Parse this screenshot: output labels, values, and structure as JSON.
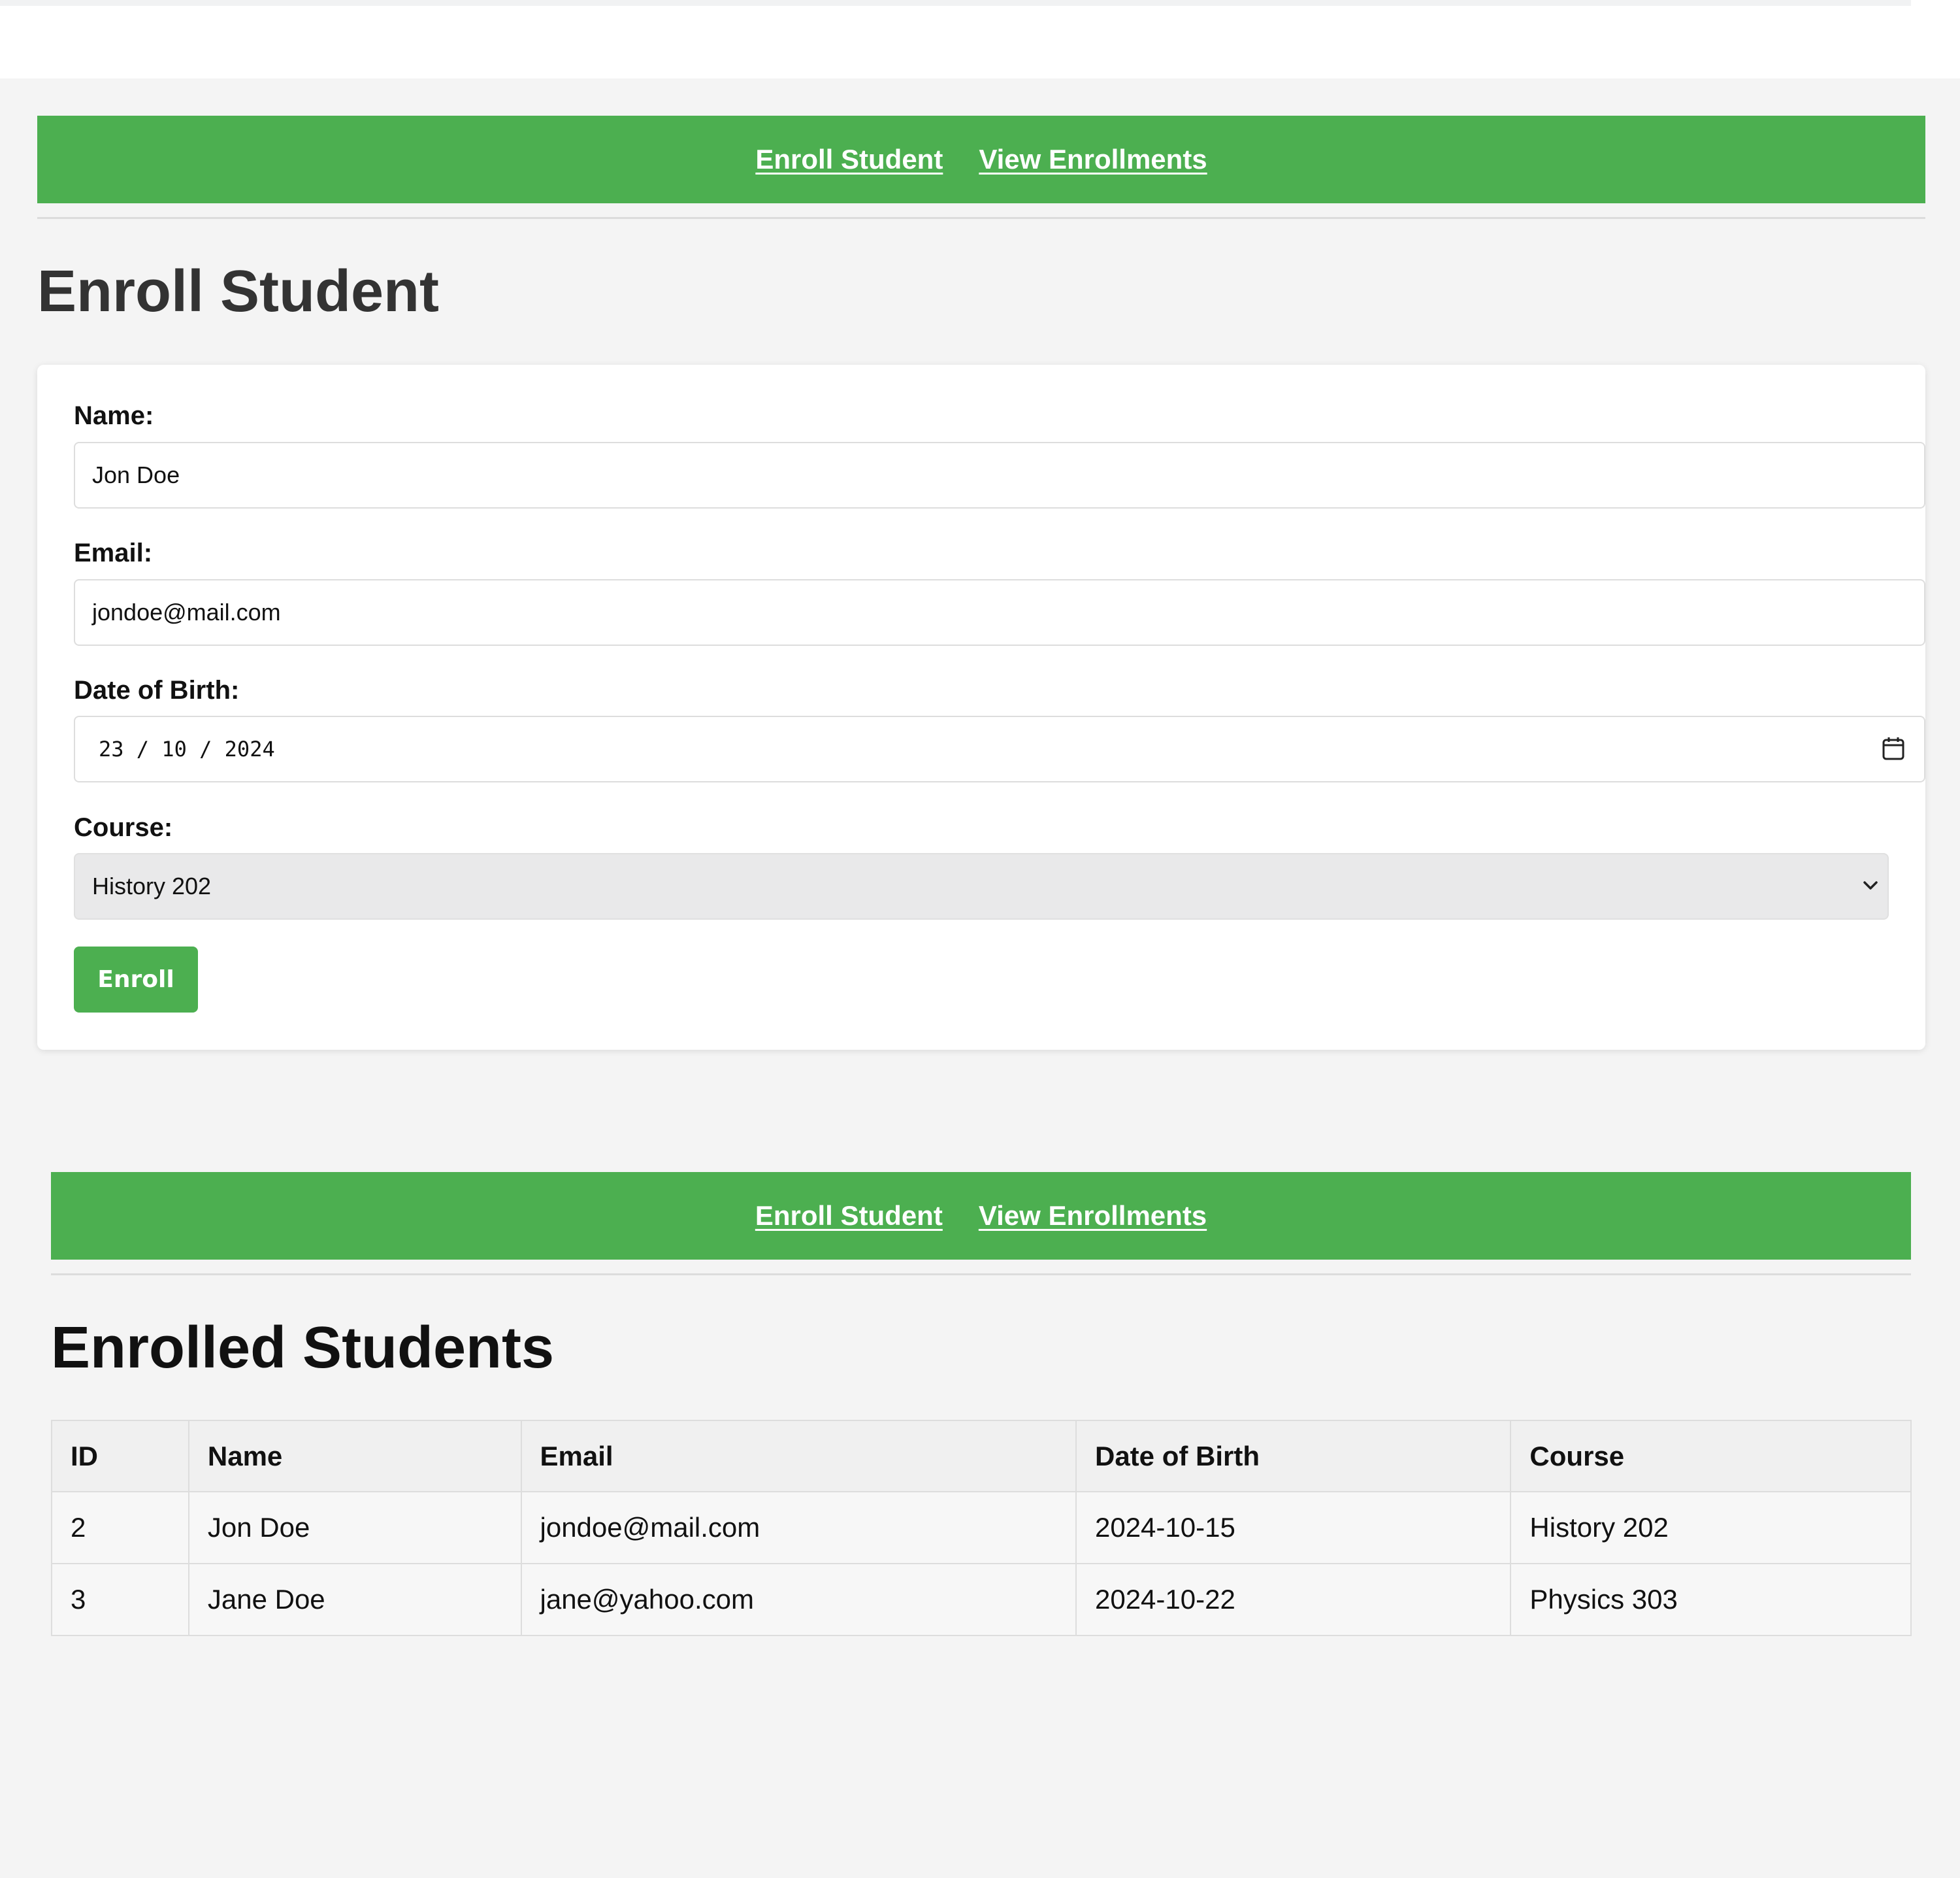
{
  "nav": {
    "enroll_link": "Enroll Student",
    "view_link": "View Enrollments"
  },
  "enroll_page": {
    "title": "Enroll Student",
    "form": {
      "name_label": "Name:",
      "name_value": "Jon Doe",
      "email_label": "Email:",
      "email_value": "jondoe@mail.com",
      "dob_label": "Date of Birth:",
      "dob_value": "23 / 10 / 2024",
      "course_label": "Course:",
      "course_value": "History 202",
      "submit_label": "Enroll"
    }
  },
  "enrollments_page": {
    "title": "Enrolled Students",
    "table": {
      "headers": [
        "ID",
        "Name",
        "Email",
        "Date of Birth",
        "Course"
      ],
      "rows": [
        [
          "2",
          "Jon Doe",
          "jondoe@mail.com",
          "2024-10-15",
          "History 202"
        ],
        [
          "3",
          "Jane Doe",
          "jane@yahoo.com",
          "2024-10-22",
          "Physics 303"
        ]
      ]
    }
  },
  "colors": {
    "accent": "#4caf50",
    "page_background": "#f4f4f4",
    "card_background": "#ffffff",
    "select_background": "#e9e9ea"
  },
  "icons": {
    "date_picker": "calendar-icon",
    "select_arrow": "chevron-down-icon"
  }
}
